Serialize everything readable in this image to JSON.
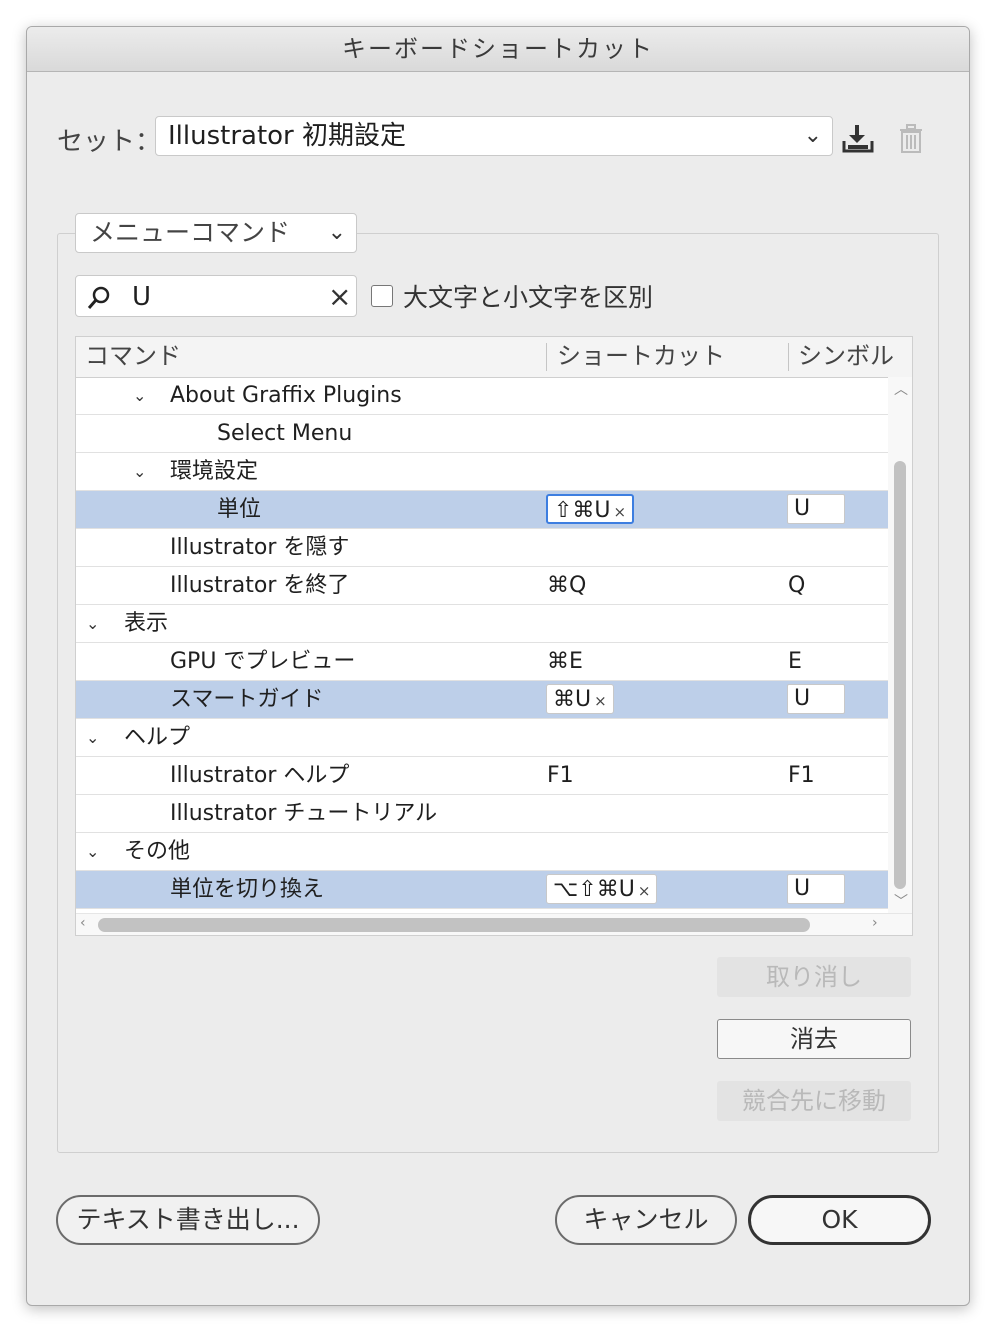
{
  "window": {
    "title": "キーボードショートカット"
  },
  "set": {
    "label": "セット：",
    "value": "Illustrator 初期設定",
    "import_icon": "download-icon",
    "delete_icon": "trash-icon"
  },
  "type_select": {
    "value": "メニューコマンド"
  },
  "search": {
    "value": "U",
    "clear_icon": "×"
  },
  "case_checkbox": {
    "label": "大文字と小文字を区別",
    "checked": false
  },
  "table": {
    "headers": [
      "コマンド",
      "ショートカット",
      "シンボル"
    ],
    "rows": [
      {
        "indent": 2,
        "twisty": "⌄",
        "label": "About Graffix Plugins",
        "shortcut": "",
        "symbol": ""
      },
      {
        "indent": 3,
        "twisty": "",
        "label": "Select Menu",
        "shortcut": "",
        "symbol": ""
      },
      {
        "indent": 2,
        "twisty": "⌄",
        "label": "環境設定",
        "shortcut": "",
        "symbol": ""
      },
      {
        "indent": 3,
        "twisty": "",
        "label": "単位",
        "shortcut": "⇧⌘U",
        "symbol": "U",
        "selected": true,
        "focused": true
      },
      {
        "indent": 2,
        "twisty": "",
        "label": "Illustrator を隠す",
        "shortcut": "",
        "symbol": ""
      },
      {
        "indent": 2,
        "twisty": "",
        "label": "Illustrator を終了",
        "shortcut": "⌘Q",
        "symbol": "Q"
      },
      {
        "indent": 1,
        "twisty": "⌄",
        "label": "表示",
        "shortcut": "",
        "symbol": ""
      },
      {
        "indent": 2,
        "twisty": "",
        "label": "GPU でプレビュー",
        "shortcut": "⌘E",
        "symbol": "E"
      },
      {
        "indent": 2,
        "twisty": "",
        "label": "スマートガイド",
        "shortcut": "⌘U",
        "symbol": "U",
        "selected": true
      },
      {
        "indent": 1,
        "twisty": "⌄",
        "label": "ヘルプ",
        "shortcut": "",
        "symbol": ""
      },
      {
        "indent": 2,
        "twisty": "",
        "label": "Illustrator ヘルプ",
        "shortcut": "F1",
        "symbol": "F1"
      },
      {
        "indent": 2,
        "twisty": "",
        "label": "Illustrator チュートリアル",
        "shortcut": "",
        "symbol": ""
      },
      {
        "indent": 1,
        "twisty": "⌄",
        "label": "その他",
        "shortcut": "",
        "symbol": ""
      },
      {
        "indent": 2,
        "twisty": "",
        "label": "単位を切り換え",
        "shortcut": "⌥⇧⌘U",
        "symbol": "U",
        "selected": true
      }
    ]
  },
  "side_buttons": {
    "undo": "取り消し",
    "clear": "消去",
    "go_to_conflict": "競合先に移動"
  },
  "footer": {
    "export_text": "テキスト書き出し...",
    "cancel": "キャンセル",
    "ok": "OK"
  },
  "colors": {
    "selection": "#bdcfe9",
    "focus_ring": "#3d7ee0",
    "dialog_bg": "#ececec"
  }
}
